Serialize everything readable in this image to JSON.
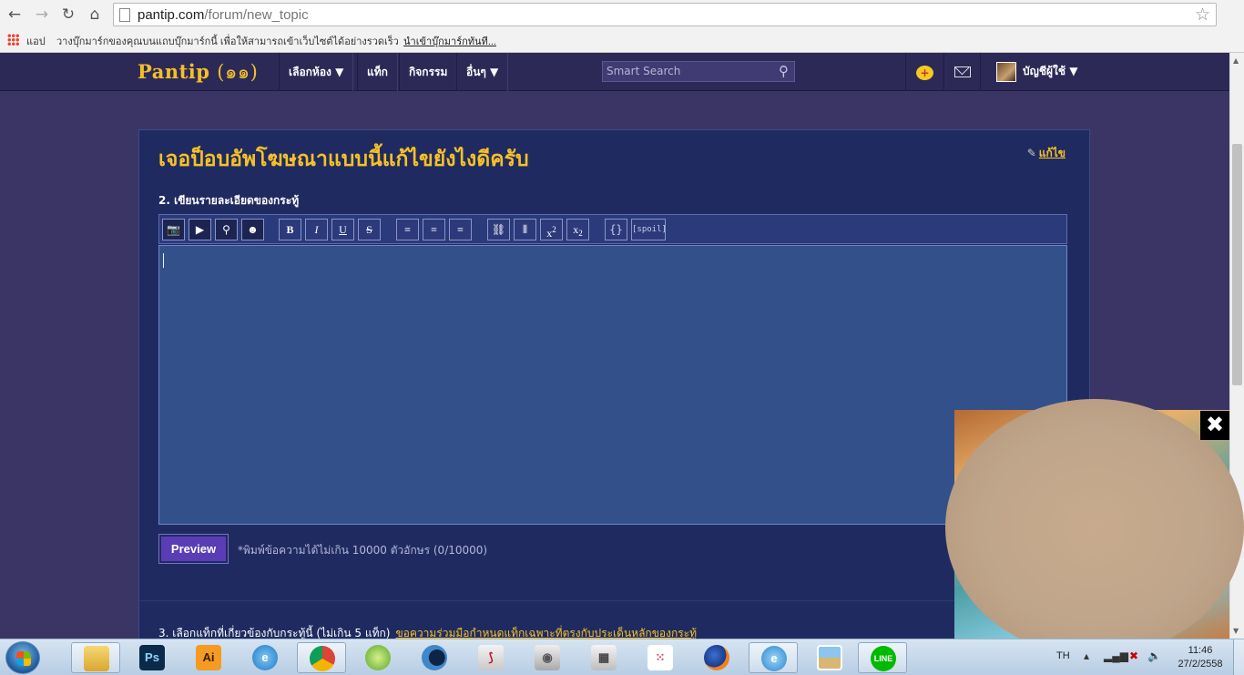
{
  "browser": {
    "url_host": "pantip.com",
    "url_path": "/forum/new_topic",
    "bookmarks": {
      "apps_label": "แอป",
      "hint": "วางบุ๊กมาร์กของคุณบนแถบบุ๊กมาร์กนี้ เพื่อให้สามารถเข้าเว็บไซต์ได้อย่างรวดเร็ว",
      "import_link": "นำเข้าบุ๊กมาร์กทันที..."
    }
  },
  "site": {
    "logo_text": "Pantip",
    "logo_thai": "(๑๑)",
    "nav": [
      "เลือกห้อง ▼",
      "แท็ก",
      "กิจกรรม",
      "อื่นๆ ▼"
    ],
    "search_placeholder": "Smart Search",
    "account_label": "บัญชีผู้ใช้ ▼"
  },
  "form": {
    "topic_title": "เจอป็อบอัพโฆษณาแบบนี้แก้ไขยังไงดีครับ",
    "edit_label": "แก้ไข",
    "step2_label": "2. เขียนรายละเอียดของกระทู้",
    "toolbar": {
      "bold": "B",
      "italic": "I",
      "underline": "U",
      "strike": "S",
      "sup": "x",
      "sup_mark": "2",
      "sub": "x",
      "sub_mark": "2",
      "code": "{}",
      "spoil": "[spoil]"
    },
    "editor_value": "",
    "preview_label": "Preview",
    "char_hint": "*พิมพ์ข้อความได้ไม่เกิน 10000 ตัวอักษร (0/10000)",
    "step3_label": "3. เลือกแท็กที่เกี่ยวข้องกับกระทู้นี้ (ไม่เกิน 5 แท็ก)",
    "step3_hint": "ขอความร่วมมือกำหนดแท็กเฉพาะที่ตรงกับประเด็นหลักของกระทู้"
  },
  "ad": {
    "close_label": "✖"
  },
  "taskbar": {
    "apps": [
      "explorer-icon",
      "photoshop-icon",
      "illustrator-icon",
      "ie-icon",
      "chrome-icon",
      "camtasia-icon",
      "app-blue-icon",
      "acrobat-icon",
      "camera-icon",
      "calculator-icon",
      "apps-grid-icon",
      "firefox-icon",
      "ie-window-icon",
      "photo-viewer-icon",
      "line-icon"
    ],
    "ps_label": "Ps",
    "ai_label": "Ai",
    "line_label": "LINE",
    "lang": "TH",
    "time": "11:46",
    "date": "27/2/2558"
  },
  "colors": {
    "accent": "#f6c127",
    "header_bg": "#2d2957",
    "panel_bg": "#1f2b60",
    "editor_bg": "#33508a",
    "preview_btn": "#5a3db4"
  }
}
